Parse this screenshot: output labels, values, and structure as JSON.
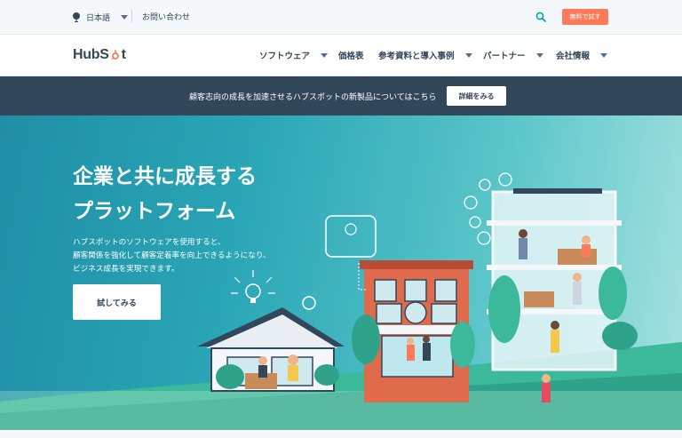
{
  "utility": {
    "language_label": "日本語",
    "contact_label": "お問い合わせ",
    "try_label": "無料で試す"
  },
  "nav": {
    "logo_text_left": "HubS",
    "logo_text_right": "t",
    "items": [
      {
        "label": "ソフトウェア",
        "has_dropdown": true
      },
      {
        "label": "価格表",
        "has_dropdown": false
      },
      {
        "label": "参考資料と導入事例",
        "has_dropdown": true
      },
      {
        "label": "パートナー",
        "has_dropdown": true
      },
      {
        "label": "会社情報",
        "has_dropdown": true
      }
    ]
  },
  "announcement": {
    "text": "顧客志向の成長を加速させるハブスポットの新製品についてはこちら",
    "button_label": "詳細をみる"
  },
  "hero": {
    "title_line1": "企業と共に成長する",
    "title_line2": "プラットフォーム",
    "sub_line1": "ハブスポットのソフトウェアを使用すると、",
    "sub_line2": "顧客関係を強化して顧客定着率を向上できるようになり、",
    "sub_line3": "ビジネス成長を実現できます。",
    "cta_label": "試してみる"
  },
  "colors": {
    "accent_orange": "#ff7a59",
    "dark_slate": "#33475b",
    "hero_teal": "#2aa6b6",
    "ground_green": "#3bb99a"
  },
  "icons": [
    "globe-icon",
    "chevron-down-icon",
    "search-icon",
    "sprocket-logo-icon"
  ]
}
